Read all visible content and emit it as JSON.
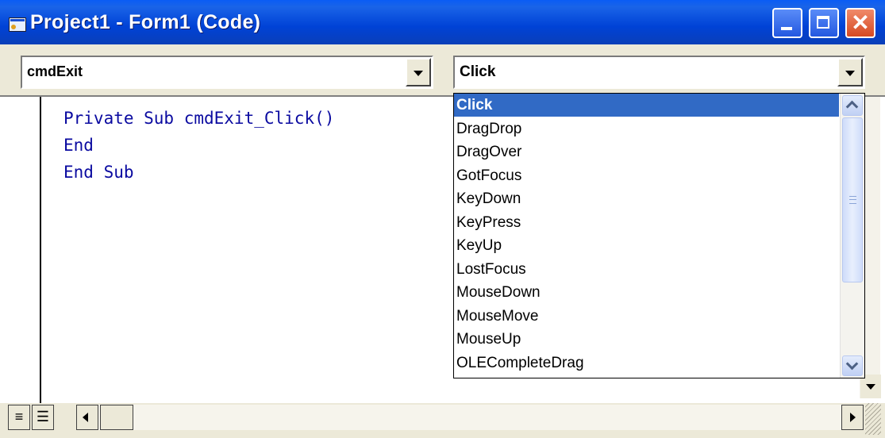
{
  "window": {
    "title": "Project1 - Form1 (Code)"
  },
  "object_combo": {
    "value": "cmdExit"
  },
  "procedure_combo": {
    "value": "Click"
  },
  "code": {
    "line1_kw1": "Private Sub",
    "line1_rest": " cmdExit_Click()",
    "line2": "End",
    "line3": "End Sub"
  },
  "dropdown": {
    "items": [
      "Click",
      "DragDrop",
      "DragOver",
      "GotFocus",
      "KeyDown",
      "KeyPress",
      "KeyUp",
      "LostFocus",
      "MouseDown",
      "MouseMove",
      "MouseUp",
      "OLECompleteDrag"
    ],
    "selected": "Click"
  },
  "icons": {
    "window_icon": "form-icon",
    "minimize": "minimize-icon",
    "maximize": "maximize-icon",
    "close": "close-icon"
  },
  "colors": {
    "titlebar": "#0042d6",
    "selection": "#316ac5",
    "keyword": "#0a0aa0",
    "close_button": "#d64a22"
  }
}
